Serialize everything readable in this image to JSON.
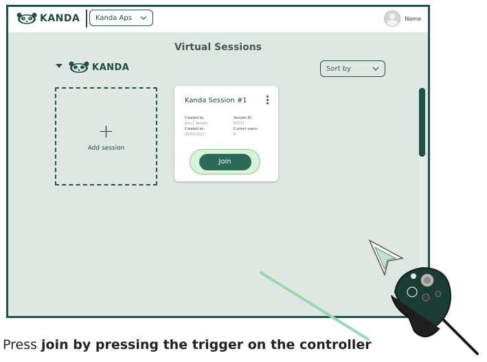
{
  "topbar": {
    "brand": "KANDA",
    "org_select": "Kanda Aps",
    "user_name": "Name"
  },
  "main": {
    "title": "Virtual Sessions",
    "section_brand": "KANDA",
    "sort_label": "Sort by",
    "add_session_label": "Add session",
    "session": {
      "title": "Kanda Session #1",
      "created_by_label": "Created by:",
      "created_by": "Jens J. Jensen",
      "session_id_label": "Session ID:",
      "session_id": "00117",
      "created_on_label": "Created on:",
      "created_on": "05/10/2021",
      "current_users_label": "Current users:",
      "current_users": "8",
      "join_label": "Join"
    }
  },
  "caption": {
    "prefix": "Press ",
    "bold": "join by pressing the trigger on the controller"
  },
  "colors": {
    "brand_dark": "#1e5248",
    "background": "#dfe7e3",
    "join_button": "#2b6b57",
    "highlight": "#7dd67d",
    "laser": "#9ad9b0"
  },
  "icons": [
    "panda-logo-icon",
    "chevron-down-icon",
    "avatar-icon",
    "triangle-down-icon",
    "plus-icon",
    "kebab-menu-icon",
    "cursor-arrow-icon",
    "vr-controller-icon"
  ]
}
